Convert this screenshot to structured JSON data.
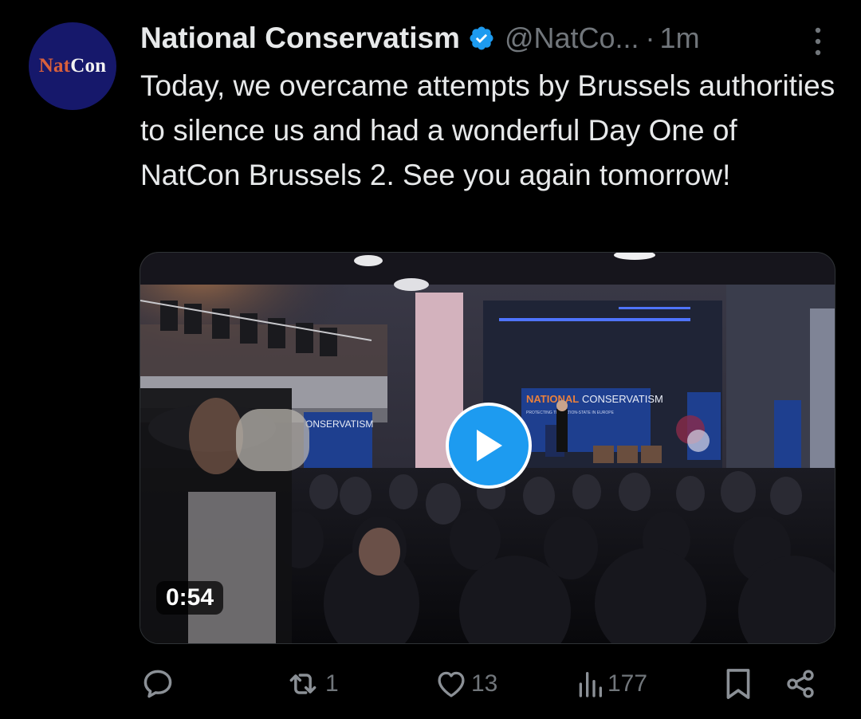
{
  "avatar": {
    "text_part1": "Nat",
    "text_part2": "Con"
  },
  "tweet": {
    "display_name": "National Conservatism",
    "handle": "@NatCo...",
    "separator": "·",
    "time": "1m",
    "text": "Today, we overcame attempts by Brussels authorities to silence us and had a wonderful Day One of NatCon Brussels 2. See you again tomorrow!"
  },
  "media": {
    "duration": "0:54",
    "stage_banner_left": "NATIONAL",
    "stage_banner_right": "CONSERVATISM",
    "stage_banner_sub": "PROTECTING THE NATION-STATE IN EUROPE",
    "side_banner": "ONSERVATISM"
  },
  "actions": {
    "reply_count": "",
    "retweet_count": "1",
    "like_count": "13",
    "views_count": "177"
  },
  "colors": {
    "accent": "#1d9bf0",
    "background": "#000000",
    "secondary_text": "#71767b"
  }
}
